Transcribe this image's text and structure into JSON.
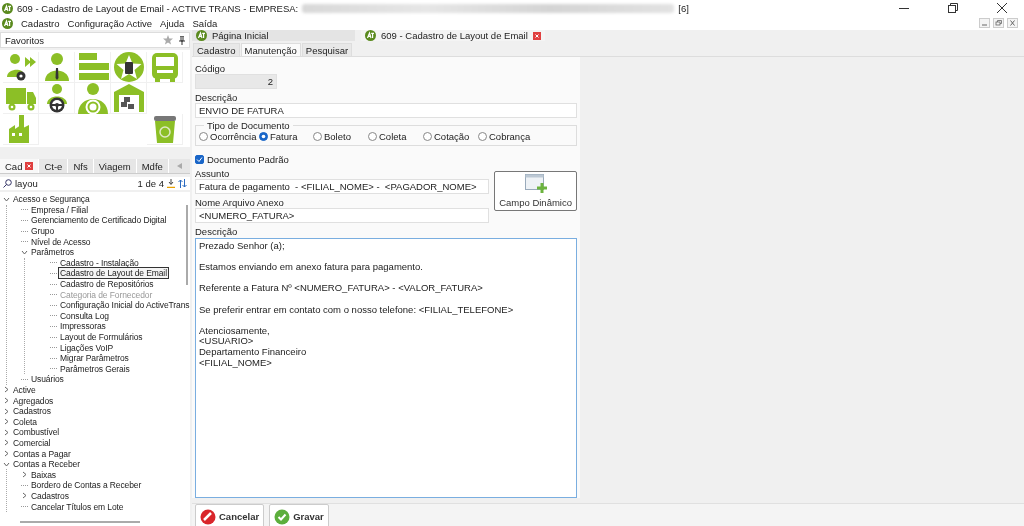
{
  "window": {
    "title": "609 - Cadastro de Layout de Email - ACTIVE TRANS - EMPRESA:",
    "title_suffix": "[6]"
  },
  "menu": [
    "Cadastro",
    "Configuração Active",
    "Ajuda",
    "Saída"
  ],
  "favorites": {
    "title": "Favoritos"
  },
  "side_tabs": [
    {
      "label": "Cad",
      "selected": true,
      "closable": true
    },
    {
      "label": "Ct-e",
      "selected": false,
      "closable": false
    },
    {
      "label": "Nfs",
      "selected": false,
      "closable": false
    },
    {
      "label": "Viagem",
      "selected": false,
      "closable": false
    },
    {
      "label": "Mdfe",
      "selected": false,
      "closable": false
    }
  ],
  "search": {
    "value": "layou",
    "result": "1 de 4"
  },
  "tree": [
    {
      "label": "Acesso e Segurança",
      "expanded": true,
      "selected": false,
      "disabled": false,
      "children": [
        {
          "label": "Empresa / Filial",
          "selected": false,
          "disabled": false
        },
        {
          "label": "Gerenciamento de Certificado Digital",
          "selected": false,
          "disabled": false
        },
        {
          "label": "Grupo",
          "selected": false,
          "disabled": false
        },
        {
          "label": "Nível de Acesso",
          "selected": false,
          "disabled": false
        },
        {
          "label": "Parâmetros",
          "expanded": true,
          "selected": false,
          "disabled": false,
          "children": [
            {
              "label": "Cadastro - Instalação",
              "selected": false,
              "disabled": false
            },
            {
              "label": "Cadastro de Layout de Email",
              "selected": true,
              "disabled": false
            },
            {
              "label": "Cadastro de Repositórios",
              "selected": false,
              "disabled": false
            },
            {
              "label": "Categoria de Fornecedor",
              "selected": false,
              "disabled": true
            },
            {
              "label": "Configuração Inicial do ActiveTrans",
              "selected": false,
              "disabled": false
            },
            {
              "label": "Consulta Log",
              "selected": false,
              "disabled": false
            },
            {
              "label": "Impressoras",
              "selected": false,
              "disabled": false
            },
            {
              "label": "Layout de Formulários",
              "selected": false,
              "disabled": false
            },
            {
              "label": "Ligações VoIP",
              "selected": false,
              "disabled": false
            },
            {
              "label": "Migrar Parâmetros",
              "selected": false,
              "disabled": false
            },
            {
              "label": "Parâmetros Gerais",
              "selected": false,
              "disabled": false
            }
          ]
        },
        {
          "label": "Usuários",
          "selected": false,
          "disabled": false
        }
      ]
    },
    {
      "label": "Active",
      "expanded": false,
      "selected": false,
      "disabled": false
    },
    {
      "label": "Agregados",
      "expanded": false,
      "selected": false,
      "disabled": false
    },
    {
      "label": "Cadastros",
      "expanded": false,
      "selected": false,
      "disabled": false
    },
    {
      "label": "Coleta",
      "expanded": false,
      "selected": false,
      "disabled": false
    },
    {
      "label": "Combustível",
      "expanded": false,
      "selected": false,
      "disabled": false
    },
    {
      "label": "Comercial",
      "expanded": false,
      "selected": false,
      "disabled": false
    },
    {
      "label": "Contas a Pagar",
      "expanded": false,
      "selected": false,
      "disabled": false
    },
    {
      "label": "Contas a Receber",
      "expanded": true,
      "selected": false,
      "disabled": false,
      "children": [
        {
          "label": "Baixas",
          "expanded": false,
          "selected": false,
          "disabled": false
        },
        {
          "label": "Bordero de Contas a Receber",
          "selected": false,
          "disabled": false
        },
        {
          "label": "Cadastros",
          "expanded": false,
          "selected": false,
          "disabled": false
        },
        {
          "label": "Cancelar Títulos em Lote",
          "selected": false,
          "disabled": false
        }
      ]
    }
  ],
  "doc_tabs": [
    {
      "label": "Página Inicial",
      "selected": false,
      "closable": false
    },
    {
      "label": "609 - Cadastro de Layout de Email",
      "selected": true,
      "closable": true
    }
  ],
  "form_tabs": [
    {
      "label": "Cadastro",
      "selected": false
    },
    {
      "label": "Manutenção",
      "selected": true
    },
    {
      "label": "Pesquisar",
      "selected": false
    }
  ],
  "form": {
    "code_label": "Código",
    "code": "2",
    "desc_label": "Descrição",
    "desc": "ENVIO DE FATURA",
    "doc_type_label": "Tipo de Documento",
    "doc_types": [
      {
        "label": "Ocorrência",
        "selected": false
      },
      {
        "label": "Fatura",
        "selected": true
      },
      {
        "label": "Boleto",
        "selected": false
      },
      {
        "label": "Coleta",
        "selected": false
      },
      {
        "label": "Cotação",
        "selected": false
      },
      {
        "label": "Cobrança",
        "selected": false
      }
    ],
    "default_doc": {
      "label": "Documento Padrão",
      "checked": true
    },
    "subject_label": "Assunto",
    "subject": "Fatura de pagamento  - <FILIAL_NOME> -  <PAGADOR_NOME>",
    "attachment_label": "Nome Arquivo Anexo",
    "attachment": "<NUMERO_FATURA>",
    "dynamic_button": "Campo Dinâmico",
    "body_label": "Descrição",
    "body": "Prezado Senhor (a);\n\nEstamos enviando em anexo fatura para pagamento.\n\nReferente a Fatura Nº <NUMERO_FATURA> - <VALOR_FATURA>\n\nSe preferir entrar em contato com o nosso telefone: <FILIAL_TELEFONE>\n\nAtenciosamente,\n<USUARIO>\nDepartamento Financeiro\n<FILIAL_NOME>"
  },
  "buttons": [
    {
      "label": "Cancelar",
      "kind": "cancel"
    },
    {
      "label": "Gravar",
      "kind": "save"
    }
  ]
}
